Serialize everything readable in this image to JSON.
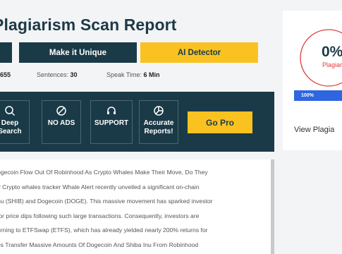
{
  "header": {
    "title": "lagiarism Scan Report"
  },
  "actions": [
    {
      "label": "",
      "style": "dark"
    },
    {
      "label": "Make it Unique",
      "style": "dark"
    },
    {
      "label": "AI Detector",
      "style": "yellow"
    }
  ],
  "stats": {
    "words_value": "655",
    "sentences_label": "Sentences:",
    "sentences_value": "30",
    "speak_label": "Speak Time:",
    "speak_value": "6 Min"
  },
  "promo": {
    "items": [
      {
        "label_line1": "Deep",
        "label_line2": "Search",
        "icon": "search-icon"
      },
      {
        "label_line1": "NO ADS",
        "label_line2": "",
        "icon": "no-ads-icon"
      },
      {
        "label_line1": "SUPPORT",
        "label_line2": "",
        "icon": "headset-icon"
      },
      {
        "label_line1": "Accurate",
        "label_line2": "Reports!",
        "icon": "chart-pie-icon"
      }
    ],
    "cta": "Go Pro"
  },
  "content": {
    "lines": [
      "ogecoin Flow Out Of Robinhood As Crypto Whales Make Their Move, Do They",
      "? Crypto whales tracker Whale Alert recently unveiled a significant on-chain",
      "nu (SHIB) and Dogecoin (DOGE). This massive movement has sparked investor",
      "for price dips following such large transactions. Consequently, investors are",
      "urning to ETFSwap (ETFS), which has already yielded nearly 200% returns for",
      "es Transfer Massive Amounts Of Dogecoin And Shiba Inu From Robinhood"
    ]
  },
  "sidebar": {
    "percent": "0%",
    "plag_label": "Plagiariz",
    "progress_value": 100,
    "progress_label": "100%",
    "view_link": "View Plagia",
    "colors": {
      "accent_blue": "#2f66e0",
      "plag_red": "#e23b3b",
      "dark": "#1b3a47",
      "yellow": "#f9c221"
    }
  }
}
